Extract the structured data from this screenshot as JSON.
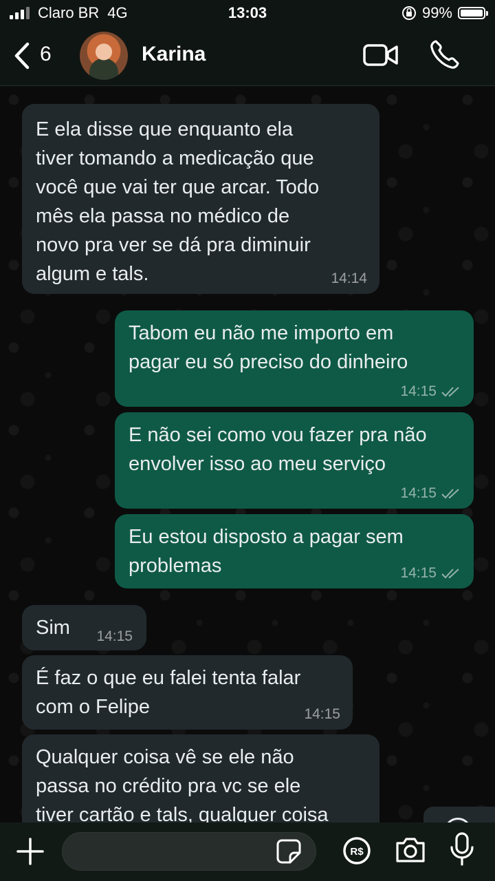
{
  "status_bar": {
    "carrier": "Claro BR",
    "network": "4G",
    "time": "13:03",
    "battery": "99%",
    "battery_level": 0.99
  },
  "header": {
    "back_count": "6",
    "contact_name": "Karina"
  },
  "messages": [
    {
      "direction": "in",
      "text": "E ela disse que enquanto ela\ntiver tomando a medicação que\nvocê que vai ter que arcar. Todo\nmês ela passa no médico de\nnovo pra ver se dá pra diminuir\nalgum e tals.",
      "time": "14:14"
    },
    {
      "direction": "out",
      "text": "Tabom eu não me importo em\npagar eu só preciso do dinheiro",
      "time": "14:15"
    },
    {
      "direction": "out",
      "text": "E não sei como vou fazer pra não\nenvolver isso ao meu serviço",
      "time": "14:15"
    },
    {
      "direction": "out",
      "text": "Eu estou disposto a pagar sem\nproblemas",
      "time": "14:15"
    },
    {
      "direction": "in",
      "text": "Sim",
      "time": "14:15"
    },
    {
      "direction": "in",
      "text": "É faz o que eu falei tenta falar\ncom o Felipe",
      "time": "14:15"
    },
    {
      "direction": "in",
      "text": "Qualquer coisa vê se ele não\npassa no crédito pra vc se ele\ntiver cartão e tals, qualquer coisa",
      "time": ""
    }
  ],
  "input": {
    "value": "",
    "placeholder": ""
  },
  "icons": {
    "back": "chevron-left-icon",
    "video": "video-camera-icon",
    "call": "phone-icon",
    "scroll": "chevron-down-icon",
    "add": "plus-icon",
    "sticker": "sticker-icon",
    "pix": "pix-money-icon",
    "camera": "camera-icon",
    "mic": "microphone-icon"
  },
  "colors": {
    "incoming_bubble": "#22292d",
    "outgoing_bubble": "#0f5a46",
    "header_bg": "#0f1512",
    "background": "#0b0b0b"
  }
}
